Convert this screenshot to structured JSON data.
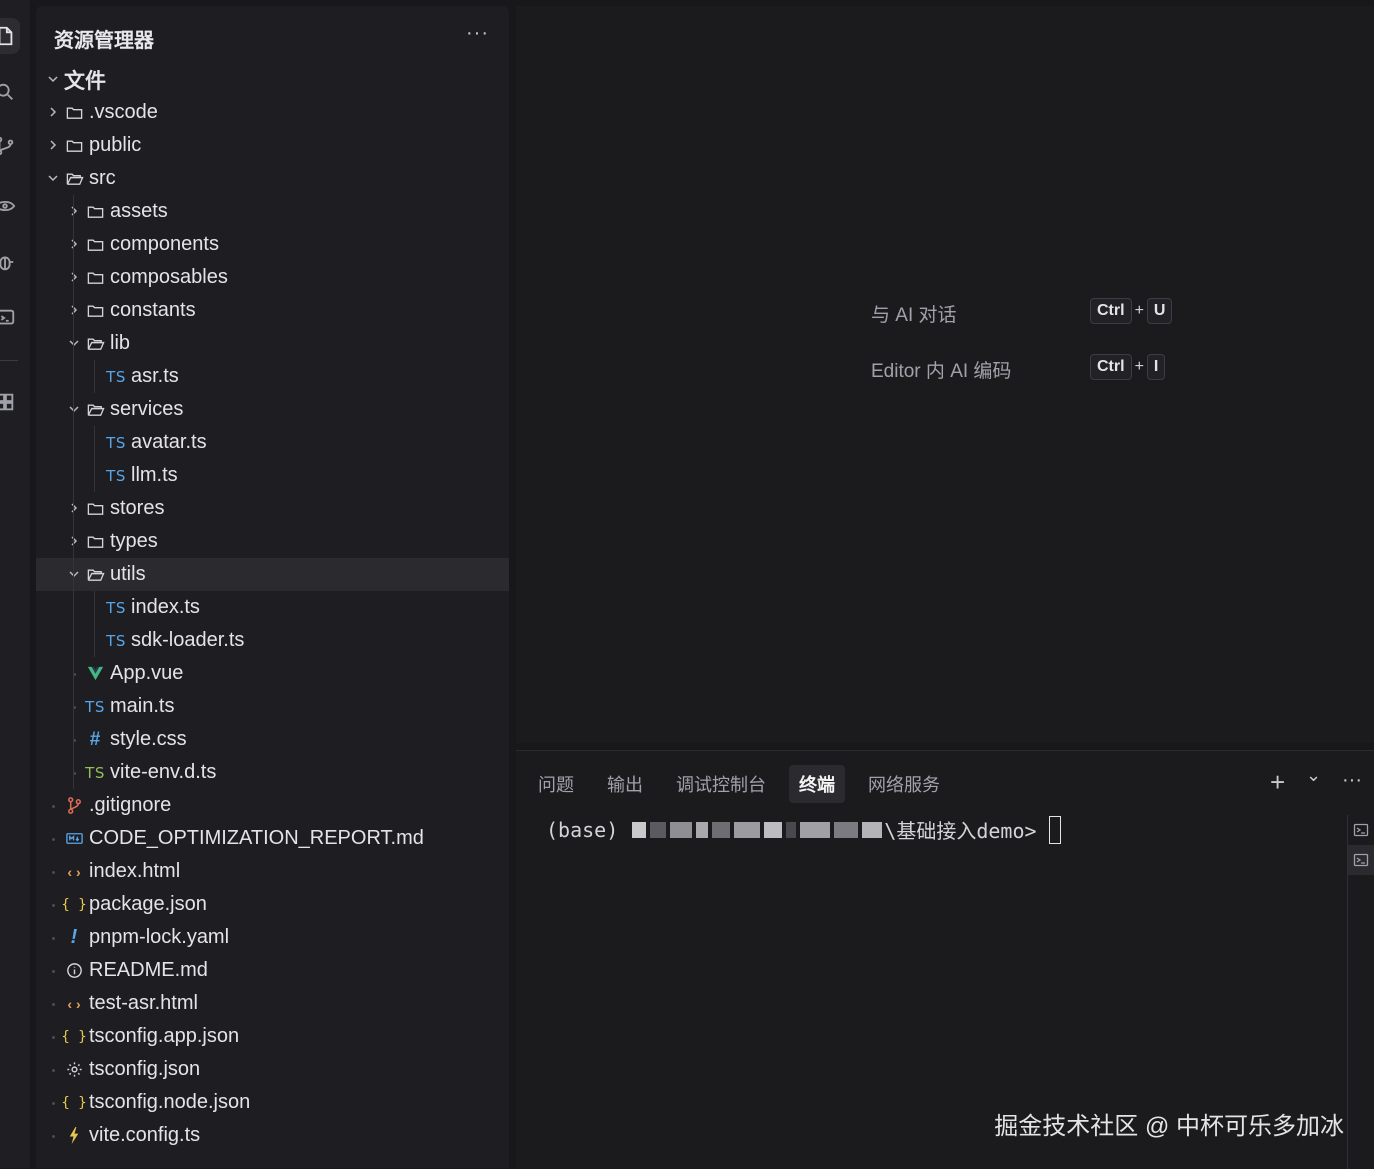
{
  "sidebar": {
    "title": "资源管理器",
    "more": "···",
    "root": "文件",
    "items": [
      {
        "label": ".vscode",
        "kind": "folder",
        "depth": 0,
        "open": false
      },
      {
        "label": "public",
        "kind": "folder",
        "depth": 0,
        "open": false
      },
      {
        "label": "src",
        "kind": "folder",
        "depth": 0,
        "open": true
      },
      {
        "label": "assets",
        "kind": "folder",
        "depth": 1,
        "open": false
      },
      {
        "label": "components",
        "kind": "folder",
        "depth": 1,
        "open": false
      },
      {
        "label": "composables",
        "kind": "folder",
        "depth": 1,
        "open": false
      },
      {
        "label": "constants",
        "kind": "folder",
        "depth": 1,
        "open": false
      },
      {
        "label": "lib",
        "kind": "folder",
        "depth": 1,
        "open": true
      },
      {
        "label": "asr.ts",
        "kind": "ts",
        "depth": 2
      },
      {
        "label": "services",
        "kind": "folder",
        "depth": 1,
        "open": true
      },
      {
        "label": "avatar.ts",
        "kind": "ts",
        "depth": 2
      },
      {
        "label": "llm.ts",
        "kind": "ts",
        "depth": 2
      },
      {
        "label": "stores",
        "kind": "folder",
        "depth": 1,
        "open": false
      },
      {
        "label": "types",
        "kind": "folder",
        "depth": 1,
        "open": false
      },
      {
        "label": "utils",
        "kind": "folder",
        "depth": 1,
        "open": true,
        "selected": true
      },
      {
        "label": "index.ts",
        "kind": "ts",
        "depth": 2
      },
      {
        "label": "sdk-loader.ts",
        "kind": "ts",
        "depth": 2
      },
      {
        "label": "App.vue",
        "kind": "vue",
        "depth": 1
      },
      {
        "label": "main.ts",
        "kind": "ts",
        "depth": 1
      },
      {
        "label": "style.css",
        "kind": "css",
        "depth": 1
      },
      {
        "label": "vite-env.d.ts",
        "kind": "ts-green",
        "depth": 1
      },
      {
        "label": ".gitignore",
        "kind": "git",
        "depth": 0
      },
      {
        "label": "CODE_OPTIMIZATION_REPORT.md",
        "kind": "md",
        "depth": 0
      },
      {
        "label": "index.html",
        "kind": "html",
        "depth": 0
      },
      {
        "label": "package.json",
        "kind": "json",
        "depth": 0
      },
      {
        "label": "pnpm-lock.yaml",
        "kind": "yaml",
        "depth": 0
      },
      {
        "label": "README.md",
        "kind": "info",
        "depth": 0
      },
      {
        "label": "test-asr.html",
        "kind": "html",
        "depth": 0
      },
      {
        "label": "tsconfig.app.json",
        "kind": "json",
        "depth": 0
      },
      {
        "label": "tsconfig.json",
        "kind": "gear",
        "depth": 0
      },
      {
        "label": "tsconfig.node.json",
        "kind": "json",
        "depth": 0
      },
      {
        "label": "vite.config.ts",
        "kind": "vite",
        "depth": 0
      }
    ]
  },
  "icons": {
    "ts_label": "TS",
    "css_label": "#",
    "json_label": "{ }",
    "html_label": "‹ ›",
    "yaml_label": "!"
  },
  "editor": {
    "hint1_label": "与 AI 对话",
    "hint1_key1": "Ctrl",
    "hint1_plus": "+",
    "hint1_key2": "U",
    "hint2_label": "Editor 内 AI 编码",
    "hint2_key1": "Ctrl",
    "hint2_plus": "+",
    "hint2_key2": "I"
  },
  "panel": {
    "tabs": [
      "问题",
      "输出",
      "调试控制台",
      "终端",
      "网络服务"
    ],
    "active_tab": "终端",
    "add": "+",
    "dropdown": "⌄",
    "more": "···",
    "terminal_prefix": "(base) ",
    "terminal_path_tail": "\\基础接入demo>"
  },
  "watermark": "掘金技术社区 @ 中杯可乐多加冰",
  "colors": {
    "ts": "#58a6e8",
    "ts_green": "#8fbf5a",
    "vue": "#41b883",
    "vite": "#e6c84a",
    "git": "#e06c55"
  }
}
